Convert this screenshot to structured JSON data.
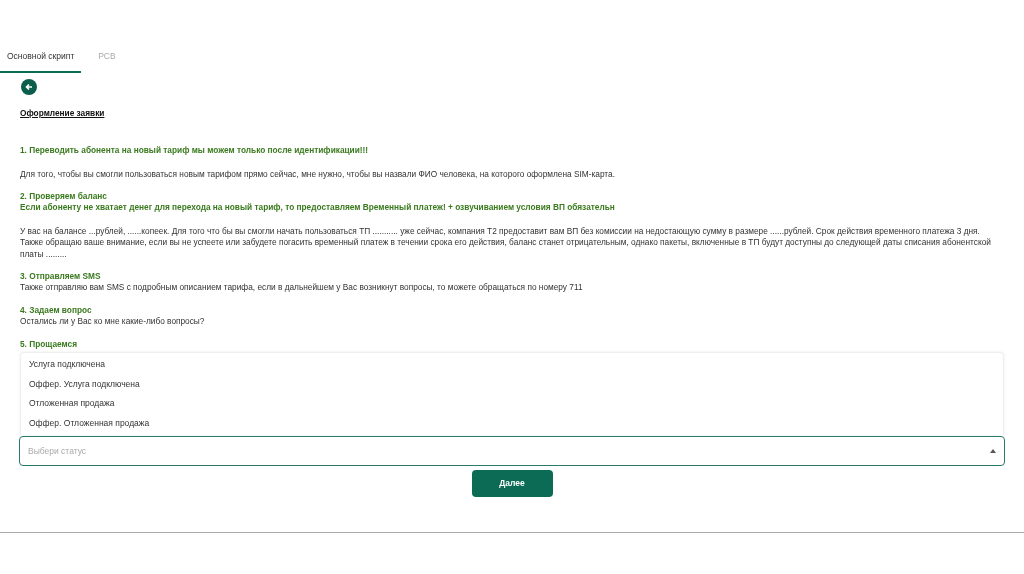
{
  "tabs": [
    {
      "label": "Основной скрипт",
      "selected": true
    },
    {
      "label": "РСВ",
      "selected": false
    }
  ],
  "title": "Оформление заявки",
  "sections": [
    {
      "headings": [
        "1. Переводить абонента на новый тариф мы можем только после идентификации!!!"
      ],
      "paragraphs": [
        "Для того, чтобы вы смогли пользоваться новым тарифом прямо сейчас, мне нужно, чтобы вы назвали ФИО человека, на которого оформлена SIM-карта."
      ],
      "kind": "spaced"
    },
    {
      "headings": [
        "2. Проверяем баланс",
        "Если абоненту не хватает денег для перехода на новый тариф, то предоставляем Временный платеж! + озвучиванием условия ВП обязательн"
      ],
      "paragraphs": [
        "У вас на балансе ...рублей, ......копеек. Для того что бы вы смогли начать пользоваться ТП ........... уже сейчас, компания Т2 предоставит вам ВП без комиссии на недостающую сумму в размере ......рублей. Срок действия временного платежа 3 дня.",
        "Также обращаю ваше внимание, если вы не успеете или забудете погасить временный платеж в течении срока его действия, баланс станет отрицательным, однако пакеты, включенные в ТП будут доступны до следующей даты списания абонентской платы ........."
      ],
      "kind": "spaced"
    },
    {
      "headings": [
        "3. Отправляем SMS"
      ],
      "paragraphs": [
        "Также отправляю вам SMS с подробным описанием тарифа, если в дальнейшем у Вас возникнут вопросы, то можете обращаться по номеру 711"
      ],
      "kind": "plain"
    },
    {
      "headings": [
        "4. Задаем вопрос"
      ],
      "paragraphs": [
        "Остались ли у Вас ко мне какие-либо вопросы?"
      ],
      "kind": "plain"
    },
    {
      "headings": [
        "5. Прощаемся"
      ]
    }
  ],
  "status_select": {
    "placeholder": "Выбери статус",
    "expanded": true,
    "options": [
      "Услуга подключена",
      "Оффер. Услуга подключена",
      "Отложенная продажа",
      "Оффер. Отложенная продажа"
    ]
  },
  "next_button": "Далее"
}
